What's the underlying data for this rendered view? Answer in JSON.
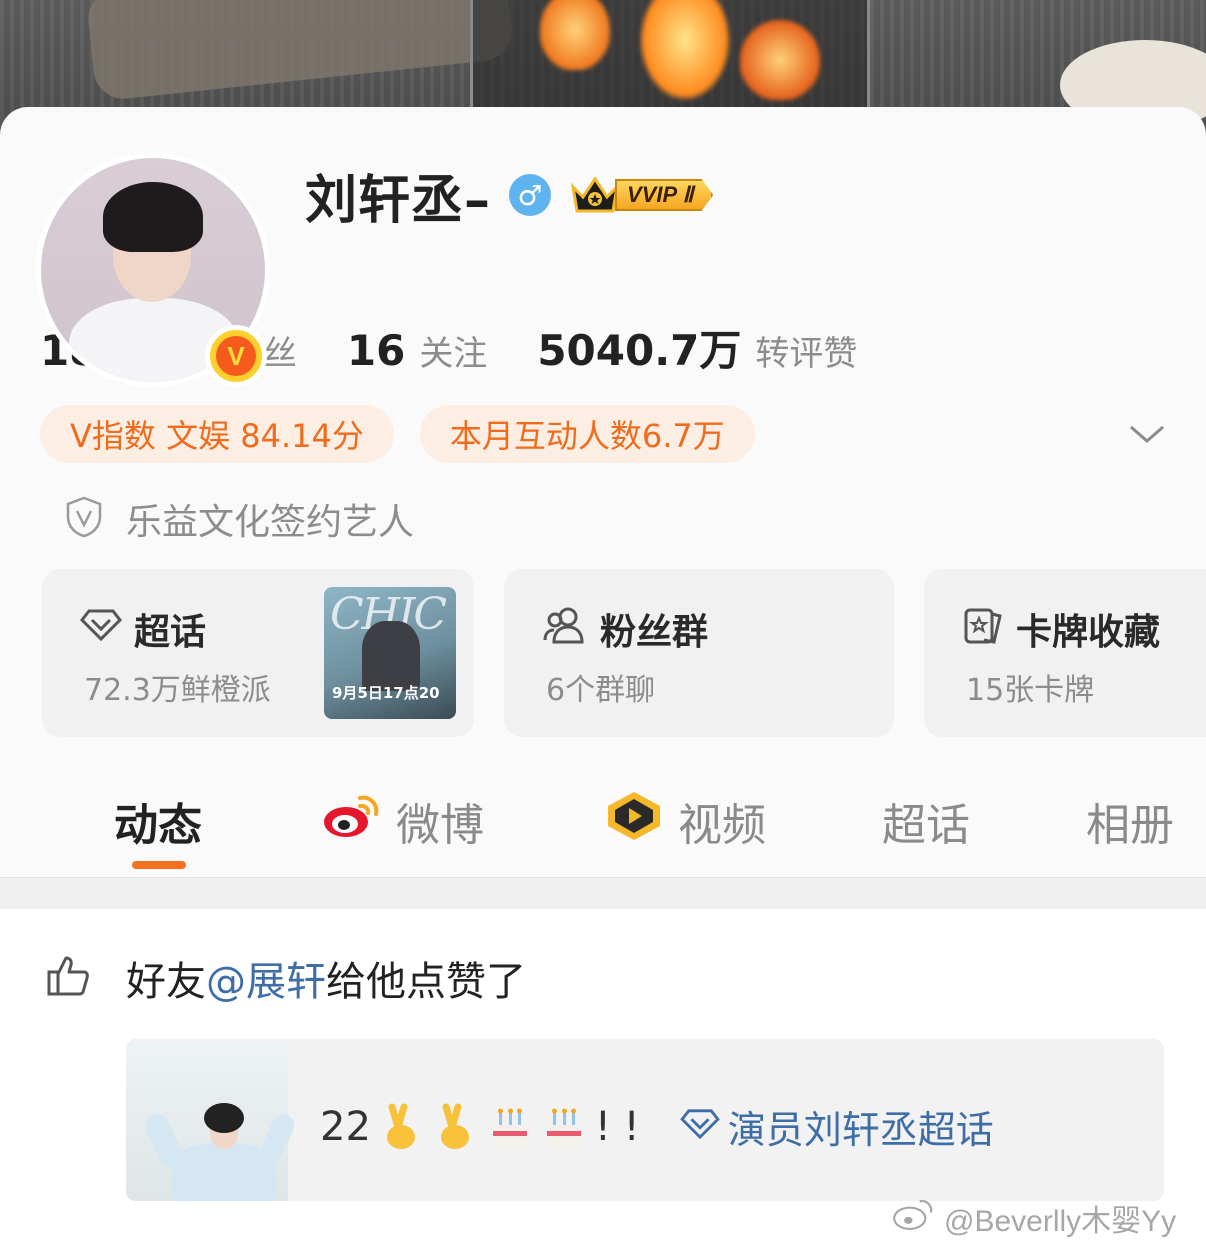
{
  "profile": {
    "name": "刘轩丞–",
    "gender_symbol": "♂",
    "vip_label": "VVIP Ⅱ",
    "verified_badge": "V"
  },
  "stats": [
    {
      "value": "187.8万",
      "label": "粉丝"
    },
    {
      "value": "16",
      "label": "关注"
    },
    {
      "value": "5040.7万",
      "label": "转评赞"
    }
  ],
  "pills": {
    "v_index": "V指数 文娱 84.14分",
    "monthly_interaction": "本月互动人数6.7万"
  },
  "signing": "乐益文化签约艺人",
  "tiles": {
    "supertopic": {
      "title": "超话",
      "sub": "72.3万鲜橙派",
      "thumb_mag": "CHIC",
      "thumb_date": "9月5日17点20"
    },
    "fangroup": {
      "title": "粉丝群",
      "sub": "6个群聊"
    },
    "cards": {
      "title": "卡牌收藏",
      "sub": "15张卡牌"
    }
  },
  "tabs": [
    {
      "label": "动态",
      "active": true
    },
    {
      "label": "微博",
      "active": false
    },
    {
      "label": "视频",
      "active": false
    },
    {
      "label": "超话",
      "active": false
    },
    {
      "label": "相册",
      "active": false
    }
  ],
  "feed": {
    "like_prefix": "好友",
    "like_mention": "@展轩",
    "like_suffix": "给他点赞了",
    "post_text": "22",
    "post_exclaim": "! !",
    "post_topic": "演员刘轩丞超话"
  },
  "watermark": "@Beverlly木婴Yy",
  "colors": {
    "accent": "#f57020",
    "pill_bg": "#fdeee4",
    "link": "#3e6da8",
    "gender": "#5fb3ef"
  }
}
